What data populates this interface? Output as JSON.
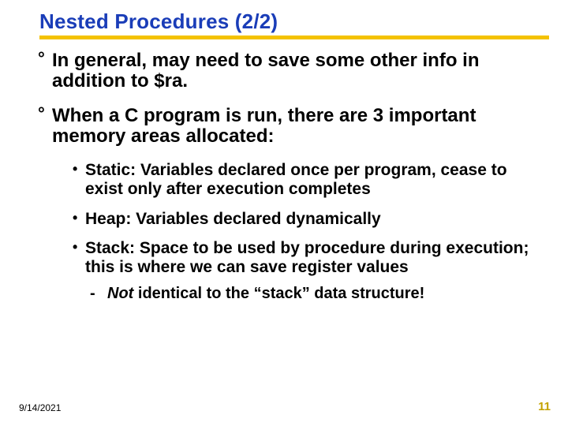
{
  "slide": {
    "title": "Nested Procedures (2/2)",
    "bullets": {
      "b1": "In general, may need to save some other info in addition to $ra.",
      "b2": "When a C program is run, there are 3 important memory areas allocated:"
    },
    "sub": {
      "s1": "Static: Variables declared once per program, cease to exist only after execution completes",
      "s2": "Heap: Variables declared dynamically",
      "s3": "Stack: Space to be used by procedure during execution; this is where we can save register values"
    },
    "dash": {
      "d1_html": "<em>Not</em> identical to the “stack” data structure!"
    }
  },
  "footer": {
    "date": "9/14/2021",
    "page": "11"
  }
}
